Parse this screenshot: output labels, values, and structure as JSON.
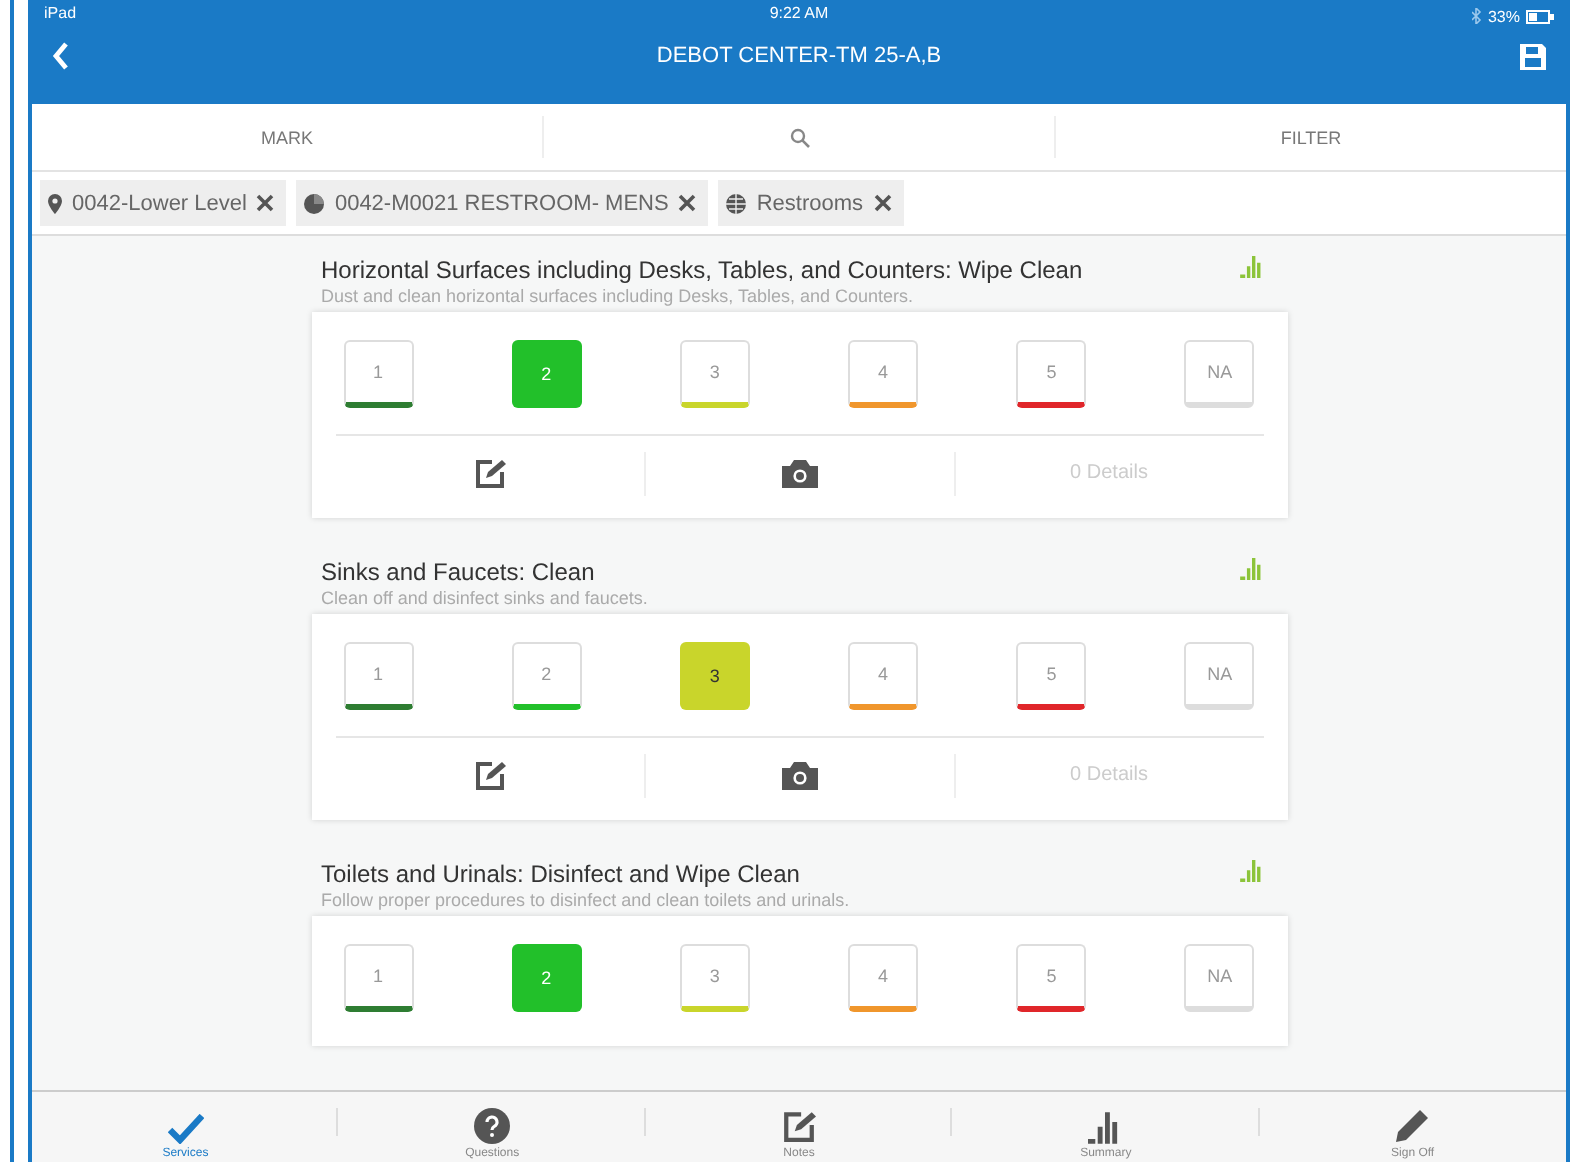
{
  "status_bar": {
    "device": "iPad",
    "time": "9:22 AM",
    "battery": "33%"
  },
  "header": {
    "title": "DEBOT CENTER-TM 25-A,B"
  },
  "toolbar": {
    "mark": "MARK",
    "filter": "FILTER"
  },
  "filters": [
    {
      "kind": "location",
      "label": "0042-Lower Level"
    },
    {
      "kind": "room",
      "label": "0042-M0021 RESTROOM- MENS"
    },
    {
      "kind": "category",
      "label": "Restrooms"
    }
  ],
  "services": [
    {
      "title": "Horizontal Surfaces including Desks, Tables, and Counters: Wipe Clean",
      "description": "Dust and clean horizontal surfaces including Desks, Tables, and Counters.",
      "details": "0 Details",
      "ratings": [
        {
          "label": "1",
          "color": "#2e7d32",
          "selected": false
        },
        {
          "label": "2",
          "color": "#22c02a",
          "selected": true
        },
        {
          "label": "3",
          "color": "#c9d52b",
          "selected": false
        },
        {
          "label": "4",
          "color": "#f0962c",
          "selected": false
        },
        {
          "label": "5",
          "color": "#e0262a",
          "selected": false
        },
        {
          "label": "NA",
          "color": "#dddddd",
          "selected": false
        }
      ]
    },
    {
      "title": "Sinks and Faucets: Clean",
      "description": "Clean off and disinfect sinks and faucets.",
      "details": "0 Details",
      "ratings": [
        {
          "label": "1",
          "color": "#2e7d32",
          "selected": false
        },
        {
          "label": "2",
          "color": "#22c02a",
          "selected": false
        },
        {
          "label": "3",
          "color": "#c9d52b",
          "selected": true
        },
        {
          "label": "4",
          "color": "#f0962c",
          "selected": false
        },
        {
          "label": "5",
          "color": "#e0262a",
          "selected": false
        },
        {
          "label": "NA",
          "color": "#dddddd",
          "selected": false
        }
      ]
    },
    {
      "title": "Toilets and Urinals: Disinfect and Wipe Clean",
      "description": "Follow proper procedures to disinfect and clean toilets and urinals.",
      "ratings": [
        {
          "label": "1",
          "color": "#2e7d32",
          "selected": false
        },
        {
          "label": "2",
          "color": "#22c02a",
          "selected": true
        },
        {
          "label": "3",
          "color": "#c9d52b",
          "selected": false
        },
        {
          "label": "4",
          "color": "#f0962c",
          "selected": false
        },
        {
          "label": "5",
          "color": "#e0262a",
          "selected": false
        },
        {
          "label": "NA",
          "color": "#dddddd",
          "selected": false
        }
      ]
    }
  ],
  "tabs": [
    {
      "kind": "check",
      "label": "Services",
      "selected": true
    },
    {
      "kind": "question",
      "label": "Questions",
      "selected": false
    },
    {
      "kind": "notes",
      "label": "Notes",
      "selected": false
    },
    {
      "kind": "summary",
      "label": "Summary",
      "selected": false
    },
    {
      "kind": "signoff",
      "label": "Sign Off",
      "selected": false
    }
  ]
}
